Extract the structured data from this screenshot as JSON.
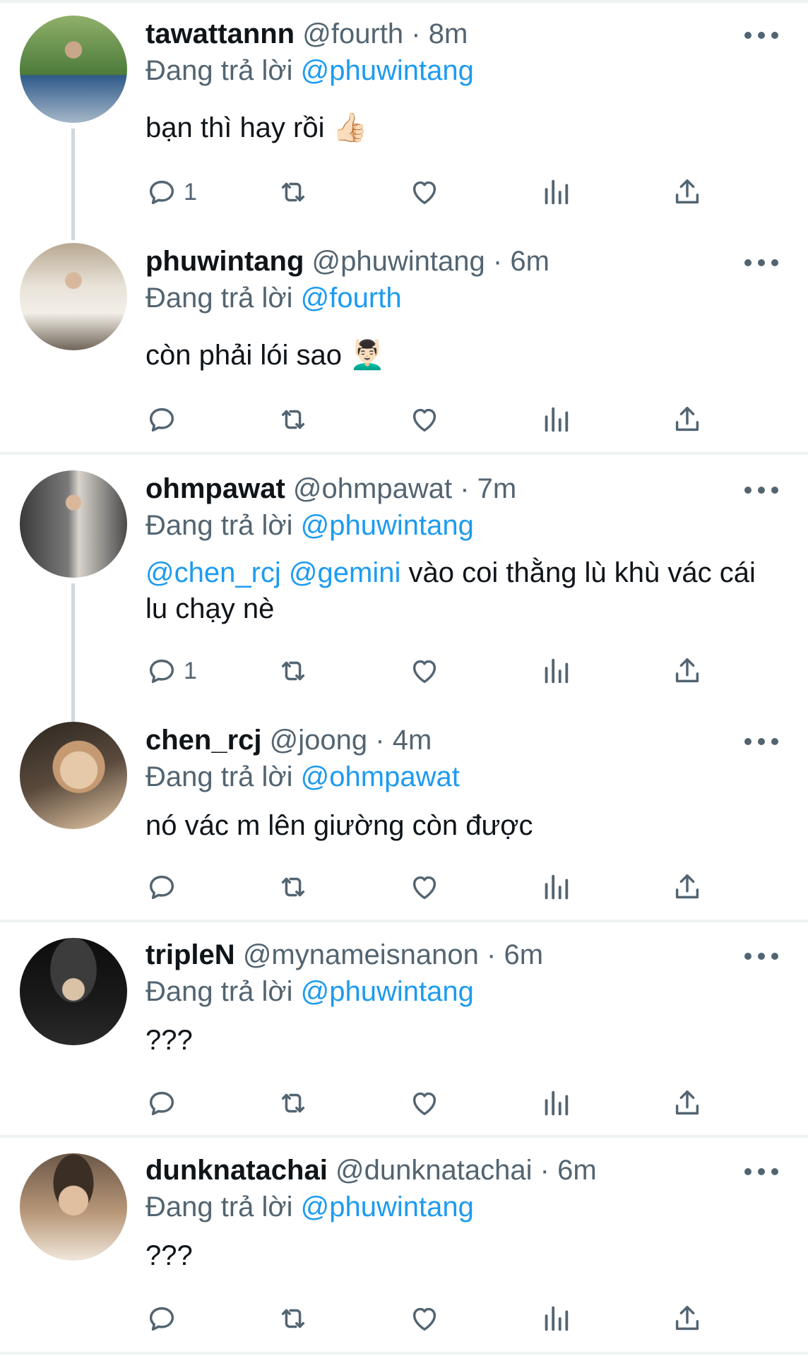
{
  "tweets": [
    {
      "name": "tawattannn",
      "handle": "@fourth",
      "dot": "·",
      "time": "8m",
      "reply_prefix": "Đang trả lời",
      "reply_to": "@phuwintang",
      "text": "bạn thì hay rồi 👍🏻",
      "reply_count": "1",
      "avatar_colors": [
        "#4d7a3a",
        "#8fb06a",
        "#2f5a8a"
      ]
    },
    {
      "name": "phuwintang",
      "handle": "@phuwintang",
      "dot": "·",
      "time": "6m",
      "reply_prefix": "Đang trả lời",
      "reply_to": "@fourth",
      "text": "còn phải lói sao 💆🏻‍♂️",
      "reply_count": "",
      "avatar_colors": [
        "#b8a892",
        "#e8e2d8",
        "#6f6558"
      ]
    },
    {
      "name": "ohmpawat",
      "handle": "@ohmpawat",
      "dot": "·",
      "time": "7m",
      "reply_prefix": "Đang trả lời",
      "reply_to": "@phuwintang",
      "mention_1": "@chen_rcj",
      "mention_2": "@gemini",
      "text": "vào coi thằng lù khù vác cái lu chạy nè",
      "reply_count": "1",
      "avatar_colors": [
        "#3a3a3a",
        "#7a7a7a",
        "#d8d3cc"
      ]
    },
    {
      "name": "chen_rcj",
      "handle": "@joong",
      "dot": "·",
      "time": "4m",
      "reply_prefix": "Đang trả lời",
      "reply_to": "@ohmpawat",
      "text": "nó vác m lên giường còn được",
      "reply_count": "",
      "avatar_colors": [
        "#2b2520",
        "#c59a72",
        "#e6c9a8"
      ]
    },
    {
      "name": "tripleN",
      "handle": "@mynameisnanon",
      "dot": "·",
      "time": "6m",
      "reply_prefix": "Đang trả lời",
      "reply_to": "@phuwintang",
      "text": "???",
      "reply_count": "",
      "avatar_colors": [
        "#0d0d0d",
        "#3c3c3c",
        "#d9c2a5"
      ]
    },
    {
      "name": "dunknatachai",
      "handle": "@dunknatachai",
      "dot": "·",
      "time": "6m",
      "reply_prefix": "Đang trả lời",
      "reply_to": "@phuwintang",
      "text": "???",
      "reply_count": "",
      "avatar_colors": [
        "#3b2e25",
        "#b89778",
        "#efe6da"
      ]
    }
  ],
  "colors": {
    "link": "#1d9bf0",
    "secondary": "#536471",
    "divider": "#eff3f4",
    "thread_line": "#cfd9de"
  },
  "icons": [
    "reply-icon",
    "retweet-icon",
    "like-icon",
    "views-icon",
    "share-icon",
    "more-icon"
  ]
}
